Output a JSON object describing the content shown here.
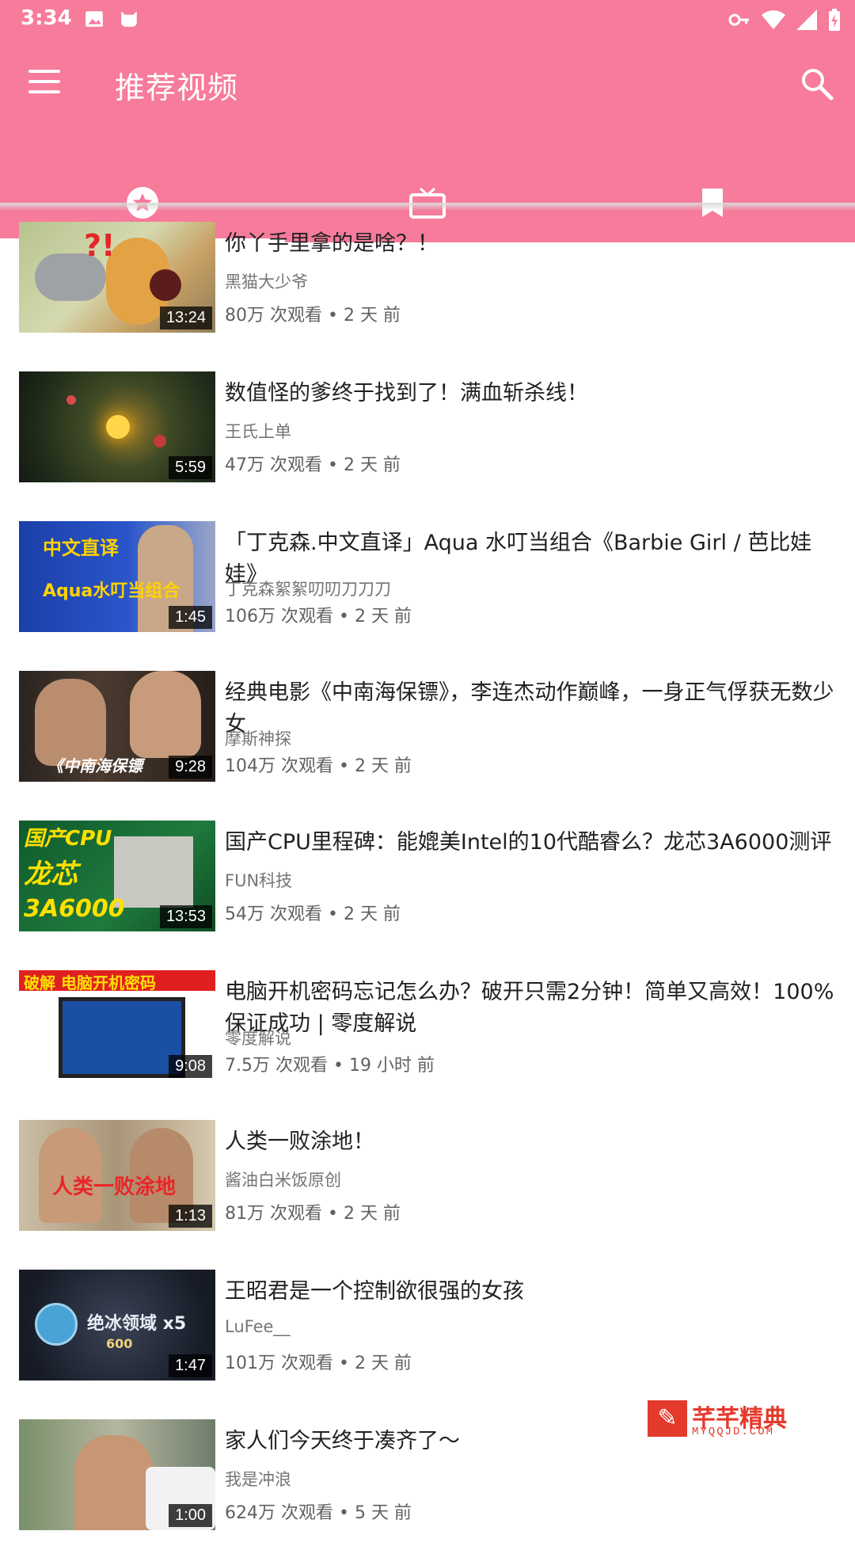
{
  "status_bar": {
    "time": "3:34",
    "left_icons": [
      "image-icon",
      "cat-icon"
    ],
    "right_icons": [
      "vpn-key-icon",
      "wifi-icon",
      "signal-icon",
      "battery-charging-icon"
    ]
  },
  "toolbar": {
    "title": "推荐视频",
    "menu_icon": "menu-icon",
    "search_icon": "search-icon",
    "background_color": "#f77b9b"
  },
  "tabs": [
    {
      "icon": "star-circle-icon",
      "selected": true
    },
    {
      "icon": "tv-icon",
      "selected": false
    },
    {
      "icon": "bookmark-icon",
      "selected": false
    }
  ],
  "videos": [
    {
      "title": "你丫手里拿的是啥？！",
      "channel": "黑猫大少爷",
      "meta": "80万 次观看 • 2 天 前",
      "duration": "13:24",
      "thumb_text": ""
    },
    {
      "title": "数值怪的爹终于找到了！满血斩杀线！",
      "channel": "王氏上单",
      "meta": "47万 次观看 • 2 天 前",
      "duration": "5:59",
      "thumb_text": ""
    },
    {
      "title": "「丁克森.中文直译」Aqua 水叮当组合《Barbie Girl / 芭比娃娃》",
      "channel": "丁克森絮絮叨叨刀刀刀",
      "meta": "106万 次观看 • 2 天 前",
      "duration": "1:45",
      "thumb_text": "中文直译"
    },
    {
      "title": "经典电影《中南海保镖》，李连杰动作巅峰，一身正气俘获无数少女",
      "channel": "摩斯神探",
      "meta": "104万 次观看 • 2 天 前",
      "duration": "9:28",
      "thumb_text": "《中南海保镖"
    },
    {
      "title": "国产CPU里程碑：能媲美Intel的10代酷睿么？龙芯3A6000测评",
      "channel": "FUN科技",
      "meta": "54万 次观看 • 2 天 前",
      "duration": "13:53",
      "thumb_text": "国产CPU"
    },
    {
      "title": "电脑开机密码忘记怎么办？破开只需2分钟！简单又高效！100%保证成功 | 零度解说",
      "channel": "零度解说",
      "meta": "7.5万 次观看 • 19 小时 前",
      "duration": "9:08",
      "thumb_text": "破解 电脑开机密码"
    },
    {
      "title": "人类一败涂地！",
      "channel": "酱油白米饭原创",
      "meta": "81万 次观看 • 2 天 前",
      "duration": "1:13",
      "thumb_text": "人类一败涂地"
    },
    {
      "title": "王昭君是一个控制欲很强的女孩",
      "channel": "LuFee__",
      "meta": "101万 次观看 • 2 天 前",
      "duration": "1:47",
      "thumb_text": "绝冰领域 x5"
    },
    {
      "title": "家人们今天终于凑齐了～",
      "channel": "我是冲浪",
      "meta": "624万 次观看 • 5 天 前",
      "duration": "1:00",
      "thumb_text": ""
    }
  ],
  "watermark": {
    "title": "芊芊精典",
    "subtitle": "MYQQJD.COM"
  }
}
